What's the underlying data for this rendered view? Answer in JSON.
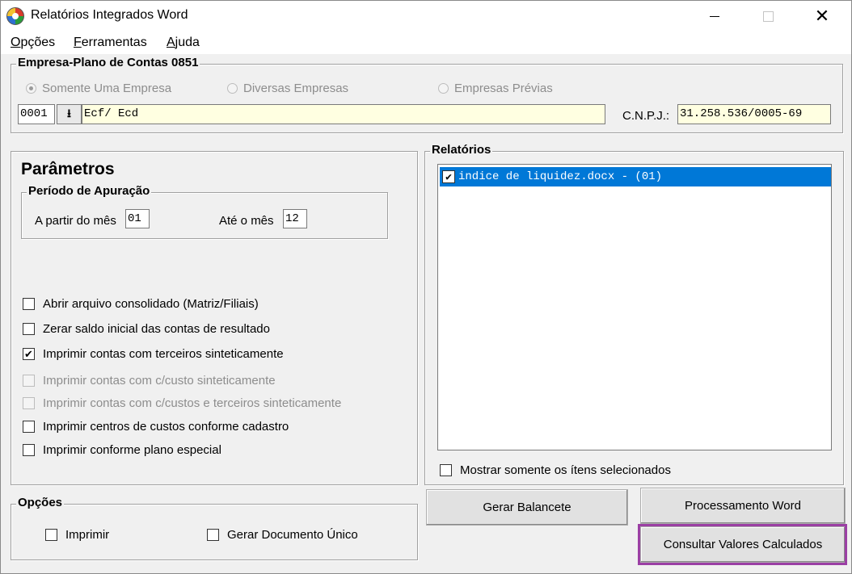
{
  "window": {
    "title": "Relatórios Integrados Word",
    "close_glyph": "✕"
  },
  "menu": [
    {
      "key": "O",
      "rest": "pções"
    },
    {
      "key": "F",
      "rest": "erramentas"
    },
    {
      "key": "A",
      "rest": "juda"
    }
  ],
  "empresa": {
    "group_title": "Empresa-Plano de Contas 0851",
    "radios": [
      "Somente Uma Empresa",
      "Diversas Empresas",
      "Empresas Prévias"
    ],
    "selected_radio": 0,
    "code": "0001",
    "name": "Ecf/ Ecd",
    "cnpj_label": "C.N.P.J.:",
    "cnpj": "31.258.536/0005-69"
  },
  "parametros": {
    "title": "Parâmetros",
    "periodo_title": "Período de Apuração",
    "from_label": "A partir do mês",
    "from_value": "01",
    "to_label": "Até o mês",
    "to_value": "12",
    "checks": [
      {
        "label": "Abrir arquivo consolidado (Matriz/Filiais)",
        "checked": false,
        "disabled": false
      },
      {
        "label": "Zerar saldo inicial das contas de resultado",
        "checked": false,
        "disabled": false
      },
      {
        "label": "Imprimir contas com terceiros sinteticamente",
        "checked": true,
        "disabled": false
      },
      {
        "label": "Imprimir contas com c/custo sinteticamente",
        "checked": false,
        "disabled": true
      },
      {
        "label": "Imprimir contas com c/custos e terceiros sinteticamente",
        "checked": false,
        "disabled": true
      },
      {
        "label": "Imprimir centros de custos conforme cadastro",
        "checked": false,
        "disabled": false
      },
      {
        "label": "Imprimir conforme plano especial",
        "checked": false,
        "disabled": false
      }
    ]
  },
  "relatorios": {
    "title": "Relatórios",
    "items": [
      {
        "label": "indice de liquidez.docx - (01)",
        "checked": true
      }
    ],
    "show_selected_label": "Mostrar somente os ítens selecionados"
  },
  "opcoes": {
    "title": "Opções",
    "imprimir": "Imprimir",
    "gerar_doc": "Gerar Documento Único"
  },
  "buttons": {
    "gerar_balancete": "Gerar Balancete",
    "processamento_word": "Processamento Word",
    "consultar": "Consultar Valores Calculados"
  },
  "colors": {
    "selection": "#0078d7",
    "highlight": "#9b3fa4",
    "field_yellow": "#ffffe1"
  }
}
